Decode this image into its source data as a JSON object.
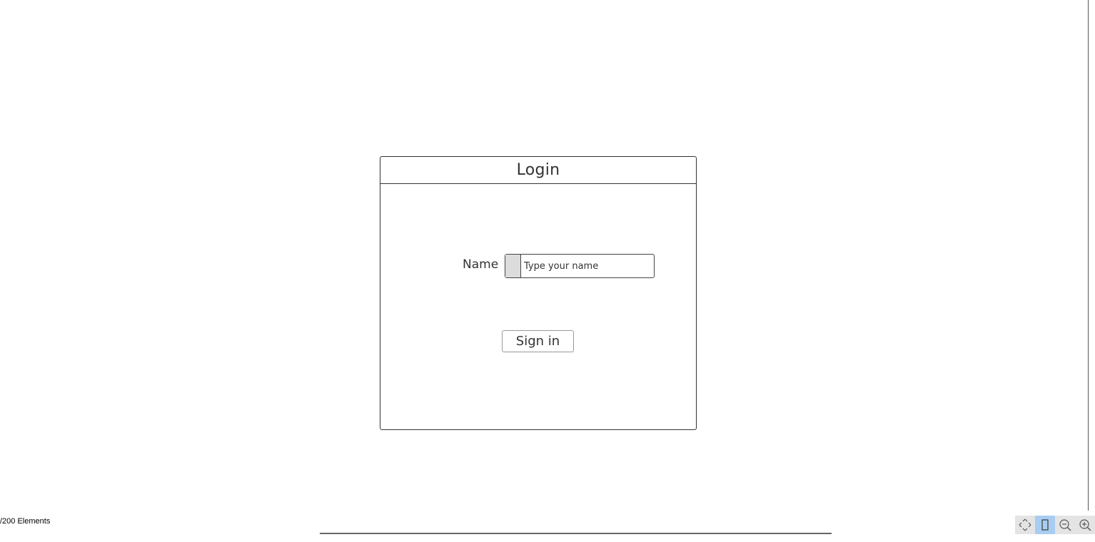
{
  "login_panel": {
    "title": "Login",
    "name_label": "Name",
    "name_input": {
      "value": "",
      "placeholder": "Type your name"
    },
    "signin_label": "Sign in"
  },
  "status": {
    "element_count": "/200 Elements"
  },
  "toolbar": {
    "buttons": [
      {
        "icon": "fit-to-screen-icon"
      },
      {
        "icon": "page-view-icon",
        "active": true
      },
      {
        "icon": "zoom-out-icon"
      },
      {
        "icon": "zoom-in-icon"
      }
    ]
  },
  "colors": {
    "stroke": "#333333",
    "active_tool": "#a9cdf2",
    "tool_bg": "#e4e4e4"
  }
}
